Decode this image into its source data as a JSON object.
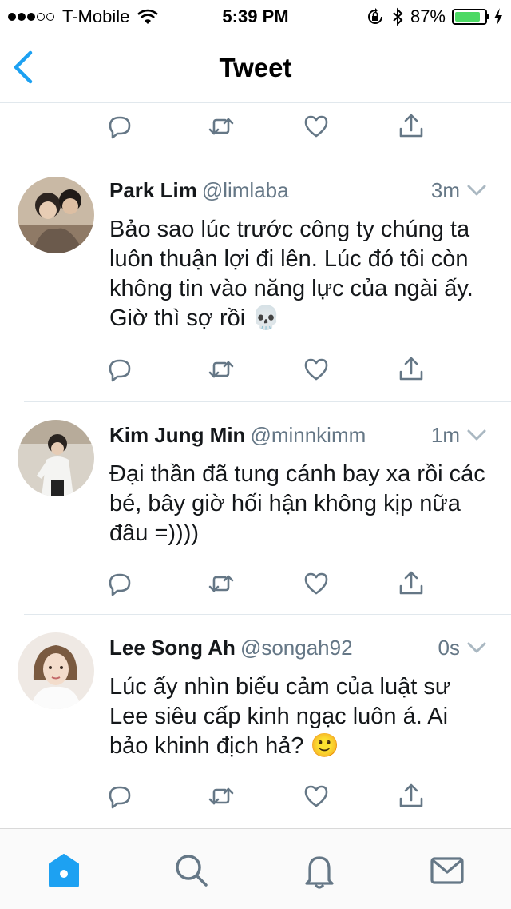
{
  "status_bar": {
    "carrier": "T-Mobile",
    "signal_bars": 3,
    "time": "5:39 PM",
    "battery": "87%",
    "battery_level": 0.87,
    "icons": [
      "wifi-icon",
      "orientation-lock-icon",
      "bluetooth-icon",
      "charging-icon"
    ]
  },
  "nav": {
    "back_icon": "chevron-left-icon",
    "title": "Tweet"
  },
  "colors": {
    "accent": "#1da1f2",
    "icon_gray": "#657786",
    "text": "#14171a",
    "battery_green": "#4cd964",
    "divider": "#e1e8ed"
  },
  "tweets": [
    {
      "name": "Park Lim",
      "handle": "@limlaba",
      "time": "3m",
      "text": "Bảo sao lúc trước công ty chúng ta luôn thuận lợi đi lên. Lúc đó tôi còn không tin vào năng lực của ngài ấy. Giờ thì sợ rồi 💀"
    },
    {
      "name": "Kim Jung Min",
      "handle": "@minnkimm",
      "time": "1m",
      "text": "Đại thần đã tung cánh bay xa rồi các bé, bây giờ hối hận không kịp nữa đâu =))))"
    },
    {
      "name": "Lee Song Ah",
      "handle": "@songah92",
      "time": "0s",
      "text": "Lúc ấy nhìn biểu cảm của luật sư Lee siêu cấp kinh ngạc luôn á. Ai bảo khinh địch hả? 🙂"
    }
  ],
  "actions": [
    "reply-icon",
    "retweet-icon",
    "like-icon",
    "share-icon"
  ],
  "tab_bar": {
    "items": [
      "home-icon",
      "search-icon",
      "notifications-icon",
      "messages-icon"
    ],
    "active": "home-icon"
  }
}
